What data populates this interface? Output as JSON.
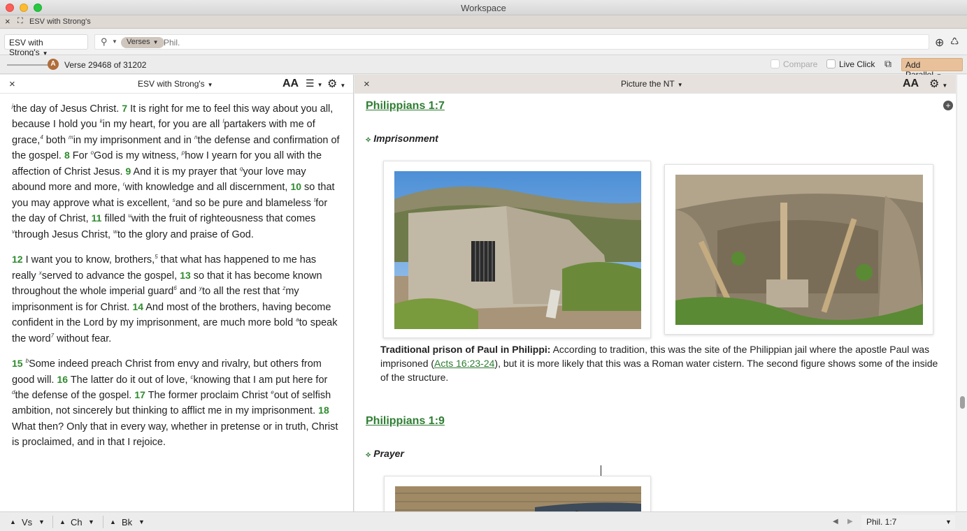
{
  "window": {
    "title": "Workspace"
  },
  "tab": {
    "label": "ESV with Strong's"
  },
  "search": {
    "resource": "ESV with Strong's",
    "mode": "Verses",
    "placeholder": "Phil."
  },
  "nav": {
    "slider_label": "A",
    "verse_count": "Verse 29468 of 31202",
    "compare": "Compare",
    "live_click": "Live Click",
    "add_parallel": "Add Parallel"
  },
  "left_pane": {
    "title": "ESV with Strong's",
    "font_icon": "AA",
    "paragraphs": [
      [
        {
          "t": "note",
          "v": "j"
        },
        {
          "t": "text",
          "v": "the day of Jesus Christ. "
        },
        {
          "t": "verse",
          "v": "7"
        },
        {
          "t": "text",
          "v": " It is right for me to feel this way about you all, because I hold you "
        },
        {
          "t": "note",
          "v": "k"
        },
        {
          "t": "text",
          "v": "in my heart, for you are all "
        },
        {
          "t": "note",
          "v": "l"
        },
        {
          "t": "text",
          "v": "partakers with me of grace,"
        },
        {
          "t": "note",
          "v": "4"
        },
        {
          "t": "text",
          "v": " both "
        },
        {
          "t": "note",
          "v": "m"
        },
        {
          "t": "text",
          "v": "in my imprisonment and in "
        },
        {
          "t": "note",
          "v": "n"
        },
        {
          "t": "text",
          "v": "the defense and confirmation of the gospel. "
        },
        {
          "t": "verse",
          "v": "8"
        },
        {
          "t": "text",
          "v": " For "
        },
        {
          "t": "note",
          "v": "o"
        },
        {
          "t": "text",
          "v": "God is my witness, "
        },
        {
          "t": "note",
          "v": "p"
        },
        {
          "t": "text",
          "v": "how I yearn for you all with the affection of Christ Jesus. "
        },
        {
          "t": "verse",
          "v": "9"
        },
        {
          "t": "text",
          "v": " And it is my prayer that "
        },
        {
          "t": "note",
          "v": "q"
        },
        {
          "t": "text",
          "v": "your love may abound more and more, "
        },
        {
          "t": "note",
          "v": "r"
        },
        {
          "t": "text",
          "v": "with knowledge and all discernment, "
        },
        {
          "t": "verse",
          "v": "10"
        },
        {
          "t": "text",
          "v": " so that you may approve what is excellent, "
        },
        {
          "t": "note",
          "v": "s"
        },
        {
          "t": "text",
          "v": "and so be pure and blameless "
        },
        {
          "t": "note",
          "v": "t"
        },
        {
          "t": "text",
          "v": "for the day of Christ, "
        },
        {
          "t": "verse",
          "v": "11"
        },
        {
          "t": "text",
          "v": " filled "
        },
        {
          "t": "note",
          "v": "u"
        },
        {
          "t": "text",
          "v": "with the fruit of righteousness that comes "
        },
        {
          "t": "note",
          "v": "v"
        },
        {
          "t": "text",
          "v": "through Jesus Christ, "
        },
        {
          "t": "note",
          "v": "w"
        },
        {
          "t": "text",
          "v": "to the glory and praise of God."
        }
      ],
      [
        {
          "t": "verse",
          "v": "12"
        },
        {
          "t": "text",
          "v": "  I want you to know, brothers,"
        },
        {
          "t": "note",
          "v": "5"
        },
        {
          "t": "text",
          "v": " that what has happened to me has really "
        },
        {
          "t": "note",
          "v": "x"
        },
        {
          "t": "text",
          "v": "served to advance the gospel, "
        },
        {
          "t": "verse",
          "v": "13"
        },
        {
          "t": "text",
          "v": " so that it has become known throughout the whole imperial guard"
        },
        {
          "t": "note",
          "v": "6"
        },
        {
          "t": "text",
          "v": " and "
        },
        {
          "t": "note",
          "v": "y"
        },
        {
          "t": "text",
          "v": "to all the rest that "
        },
        {
          "t": "note",
          "v": "z"
        },
        {
          "t": "text",
          "v": "my imprisonment is for Christ. "
        },
        {
          "t": "verse",
          "v": "14"
        },
        {
          "t": "text",
          "v": " And most of the brothers, having become confident in the Lord by my imprisonment, are much more bold "
        },
        {
          "t": "note",
          "v": "a"
        },
        {
          "t": "text",
          "v": "to speak the word"
        },
        {
          "t": "note",
          "v": "7"
        },
        {
          "t": "text",
          "v": " without fear."
        }
      ],
      [
        {
          "t": "verse",
          "v": "15"
        },
        {
          "t": "text",
          "v": "  "
        },
        {
          "t": "note",
          "v": "b"
        },
        {
          "t": "text",
          "v": "Some indeed preach Christ from envy and rivalry, but others from good will. "
        },
        {
          "t": "verse",
          "v": "16"
        },
        {
          "t": "text",
          "v": " The latter do it out of love, "
        },
        {
          "t": "note",
          "v": "c"
        },
        {
          "t": "text",
          "v": "knowing that I am put here for "
        },
        {
          "t": "note",
          "v": "d"
        },
        {
          "t": "text",
          "v": "the defense of the gospel. "
        },
        {
          "t": "verse",
          "v": "17"
        },
        {
          "t": "text",
          "v": " The former proclaim Christ "
        },
        {
          "t": "note",
          "v": "e"
        },
        {
          "t": "text",
          "v": "out of selfish ambition, not sincerely but thinking to afflict me in my imprisonment. "
        },
        {
          "t": "verse",
          "v": "18"
        },
        {
          "t": "text",
          "v": " What then? Only that in every way, whether in pretense or in truth, Christ is proclaimed, and in that I rejoice."
        }
      ]
    ]
  },
  "right_pane": {
    "title": "Picture the NT",
    "font_icon": "AA",
    "ref1": "Philippians 1:7",
    "section1": "Imprisonment",
    "caption_bold": "Traditional prison of Paul in Philippi:",
    "caption_pre": " According to tradition, this was the site of the Philippian jail where the apostle Paul was imprisoned (",
    "caption_link": "Acts 16:23-24",
    "caption_post": "), but it is more likely that this was a Roman water cistern. The second figure shows some of the inside of the structure.",
    "ref2": "Philippians 1:9",
    "section2": "Prayer"
  },
  "bottom": {
    "vs": "Vs",
    "ch": "Ch",
    "bk": "Bk",
    "reference": "Phil. 1:7"
  },
  "colors": {
    "accent_green": "#2e7d32",
    "add_parallel_bg": "#e8c19b",
    "header_tan": "#e6e1dc"
  }
}
